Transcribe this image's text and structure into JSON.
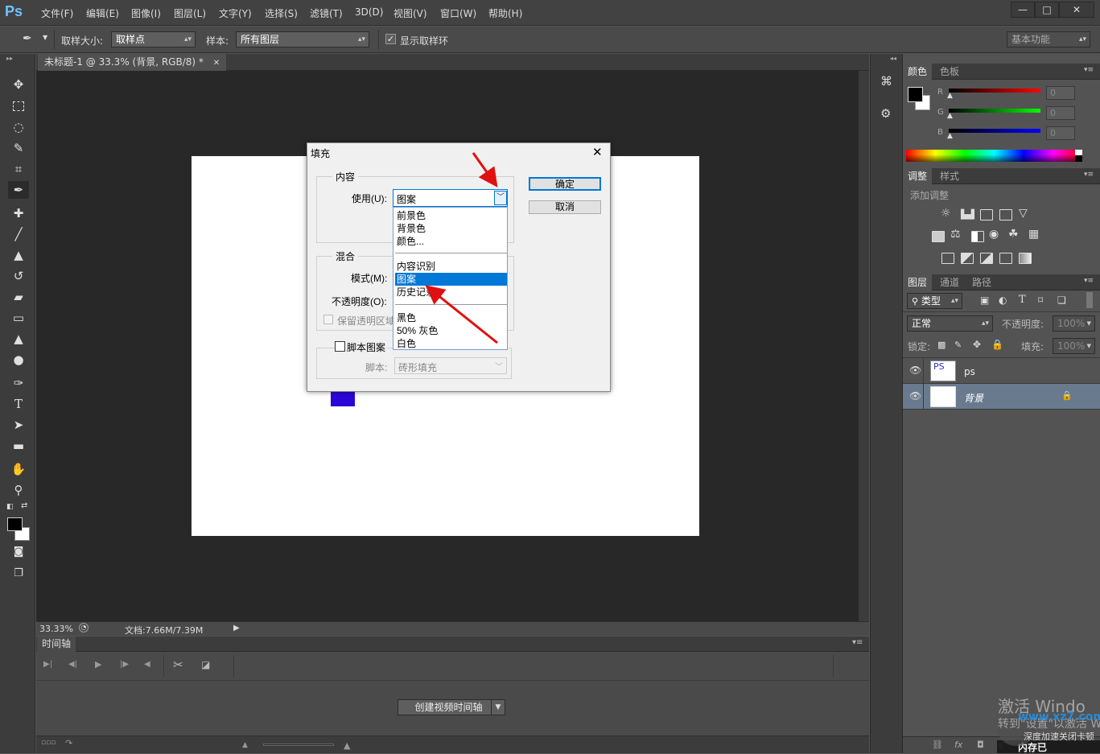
{
  "app": {
    "logo": "Ps"
  },
  "menubar": {
    "items": [
      "文件(F)",
      "编辑(E)",
      "图像(I)",
      "图层(L)",
      "文字(Y)",
      "选择(S)",
      "滤镜(T)",
      "3D(D)",
      "视图(V)",
      "窗口(W)",
      "帮助(H)"
    ]
  },
  "window_controls": {
    "minimize": "—",
    "maximize": "□",
    "close": "✕"
  },
  "options_bar": {
    "sample_size_label": "取样大小:",
    "sample_size_value": "取样点",
    "sample_label": "样本:",
    "sample_value": "所有图层",
    "show_ring_label": "显示取样环",
    "show_ring_checked": true,
    "workspace": "基本功能"
  },
  "document": {
    "tab_title": "未标题-1 @ 33.3% (背景, RGB/8) *",
    "zoom": "33.33%",
    "doc_info": "文档:7.66M/7.39M",
    "swatch_color": "#2b06d6"
  },
  "timeline": {
    "title": "时间轴",
    "create_button": "创建视频时间轴"
  },
  "panels": {
    "color_tab": "颜色",
    "swatches_tab": "色板",
    "channels": [
      {
        "label": "R",
        "value": "0",
        "color": "#e00000"
      },
      {
        "label": "G",
        "value": "0",
        "color": "#00c000"
      },
      {
        "label": "B",
        "value": "0",
        "color": "#0000e0"
      }
    ],
    "adjust_tab": "调整",
    "styles_tab": "样式",
    "add_adjustment": "添加调整",
    "layers_tab": "图层",
    "channels_tab": "通道",
    "paths_tab": "路径",
    "filter_kind": "类型",
    "blend_mode": "正常",
    "opacity_label": "不透明度:",
    "opacity_value": "100%",
    "lock_label": "锁定:",
    "fill_label": "填充:",
    "fill_value": "100%",
    "layers": [
      {
        "name": "ps",
        "thumb": "PS"
      },
      {
        "name": "背景"
      }
    ]
  },
  "dialog": {
    "title": "填充",
    "content_group": "内容",
    "use_label": "使用(U):",
    "use_value": "图案",
    "ok": "确定",
    "cancel": "取消",
    "blend_group": "混合",
    "mode_label": "模式(M):",
    "opacity_label": "不透明度(O):",
    "preserve_label": "保留透明区域",
    "script_pattern_label": "脚本图案",
    "script_label": "脚本:",
    "script_value": "砖形填充",
    "dropdown_options": [
      "前景色",
      "背景色",
      "颜色...",
      "内容识别",
      "图案",
      "历史记录",
      "黑色",
      "50% 灰色",
      "白色"
    ],
    "selected_option": "图案"
  },
  "watermark": {
    "line1": "激活 Windo",
    "line2": "转到\"设置\"以激活 W",
    "notice": "内存已",
    "notice2": "深度加速关闭卡顿",
    "site": "www.xz7.com"
  }
}
